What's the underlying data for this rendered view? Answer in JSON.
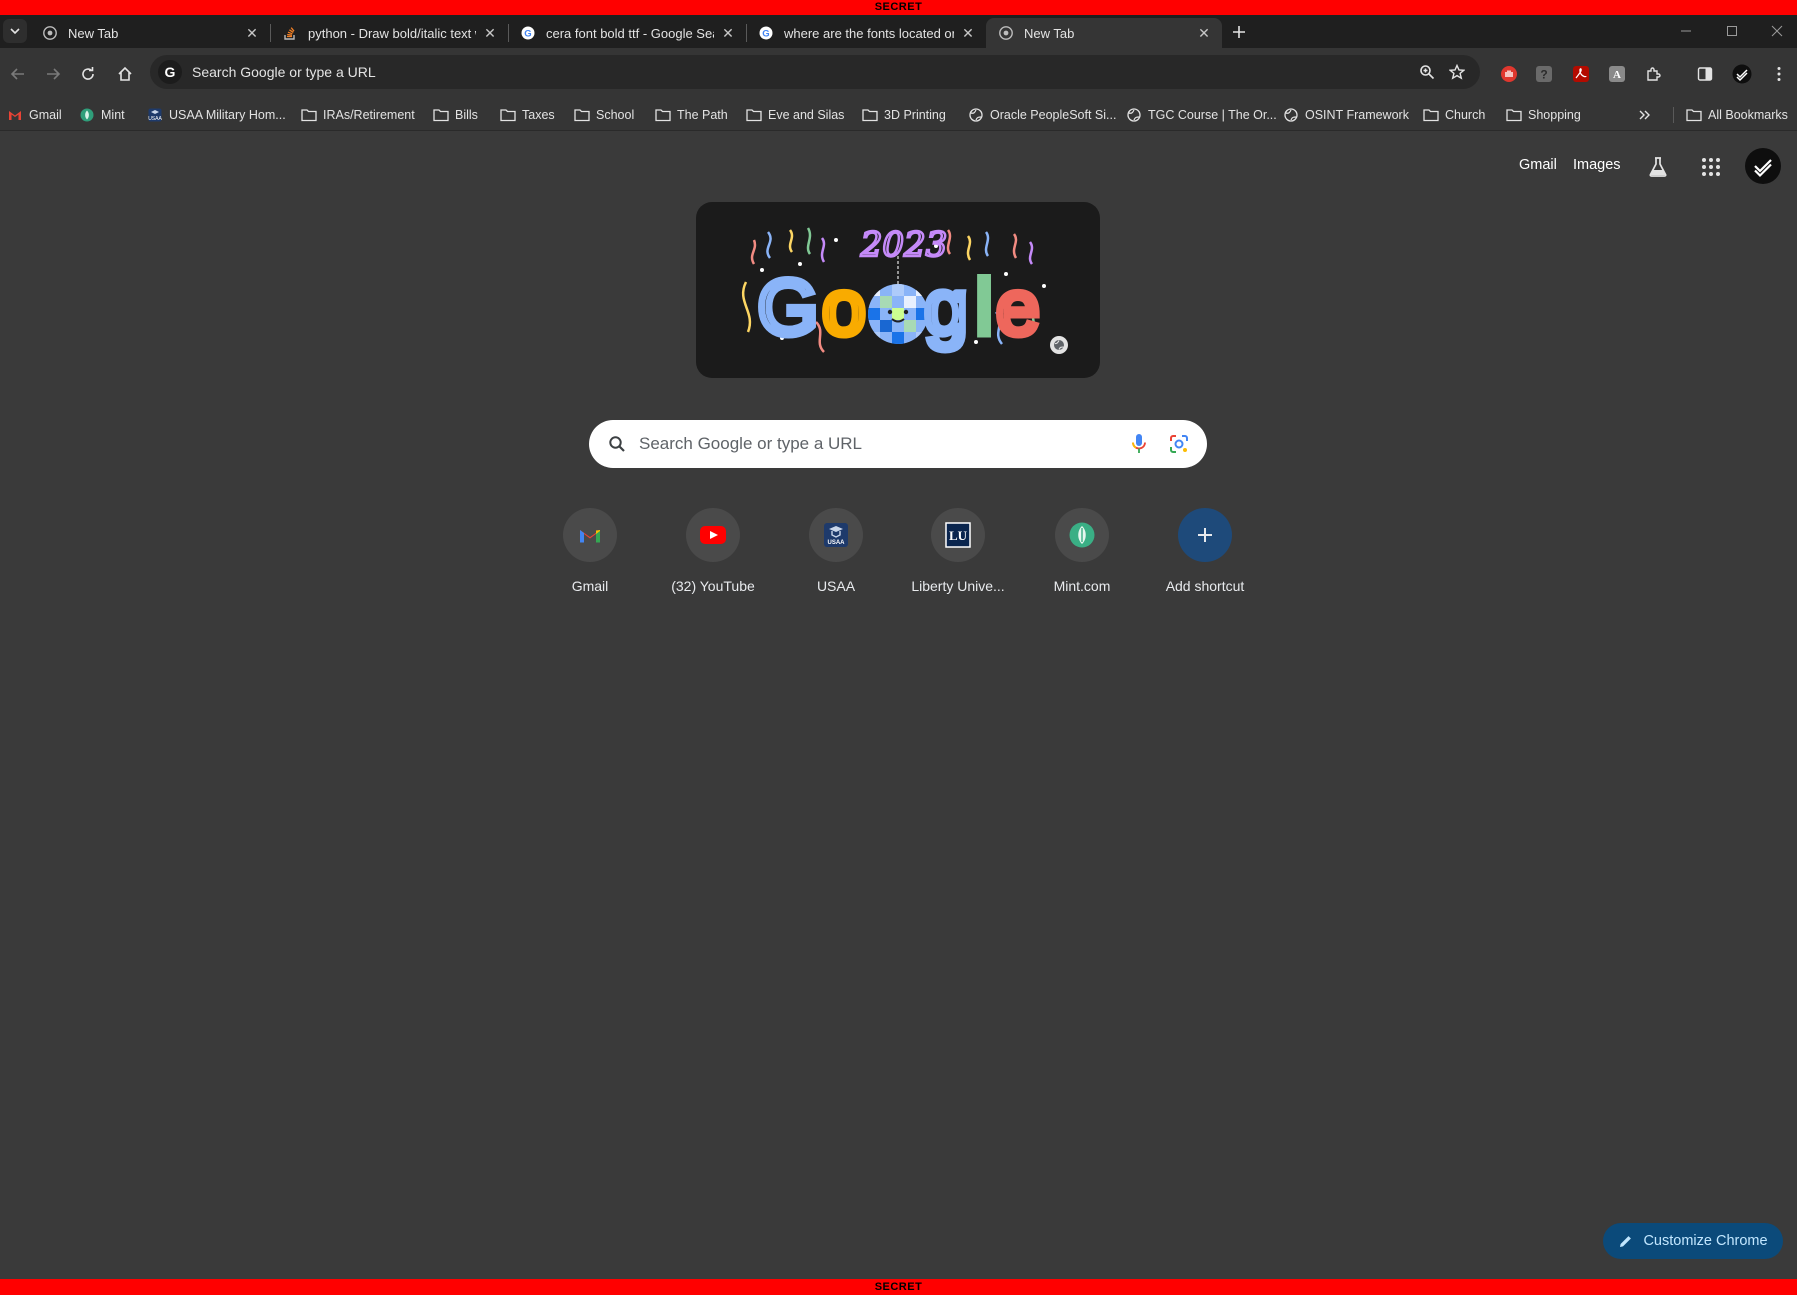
{
  "banner": {
    "top": "SECRET",
    "bottom": "SECRET"
  },
  "tabs": [
    {
      "title": "New Tab",
      "favicon": "chrome-icon",
      "active": false
    },
    {
      "title": "python - Draw bold/italic text w",
      "favicon": "stackoverflow-icon",
      "active": false
    },
    {
      "title": "cera font bold ttf - Google Sear",
      "favicon": "google-icon",
      "active": false
    },
    {
      "title": "where are the fonts located on",
      "favicon": "google-icon",
      "active": false
    },
    {
      "title": "New Tab",
      "favicon": "chrome-icon",
      "active": true
    }
  ],
  "omnibox": {
    "text": "Search Google or type a URL"
  },
  "bookmarks": [
    {
      "label": "Gmail",
      "icon": "gmail-icon"
    },
    {
      "label": "Mint",
      "icon": "mint-icon"
    },
    {
      "label": "USAA Military Hom...",
      "icon": "usaa-icon"
    },
    {
      "label": "IRAs/Retirement",
      "icon": "folder-icon"
    },
    {
      "label": "Bills",
      "icon": "folder-icon"
    },
    {
      "label": "Taxes",
      "icon": "folder-icon"
    },
    {
      "label": "School",
      "icon": "folder-icon"
    },
    {
      "label": "The Path",
      "icon": "folder-icon"
    },
    {
      "label": "Eve and Silas",
      "icon": "folder-icon"
    },
    {
      "label": "3D Printing",
      "icon": "folder-icon"
    },
    {
      "label": "Oracle PeopleSoft Si...",
      "icon": "globe-icon"
    },
    {
      "label": "TGC Course | The Or...",
      "icon": "globe-icon"
    },
    {
      "label": "OSINT Framework",
      "icon": "globe-icon"
    },
    {
      "label": "Church",
      "icon": "folder-icon"
    },
    {
      "label": "Shopping",
      "icon": "folder-icon"
    }
  ],
  "all_bookmarks": "All Bookmarks",
  "header_links": {
    "gmail": "Gmail",
    "images": "Images"
  },
  "search": {
    "placeholder": "Search Google or type a URL"
  },
  "shortcuts": [
    {
      "label": "Gmail",
      "icon": "gmail-icon"
    },
    {
      "label": "(32) YouTube",
      "icon": "youtube-icon"
    },
    {
      "label": "USAA",
      "icon": "usaa-icon"
    },
    {
      "label": "Liberty Unive...",
      "icon": "liberty-icon"
    },
    {
      "label": "Mint.com",
      "icon": "mint-icon"
    },
    {
      "label": "Add shortcut",
      "icon": "plus-icon"
    }
  ],
  "customize": "Customize Chrome",
  "doodle_year": "2023"
}
